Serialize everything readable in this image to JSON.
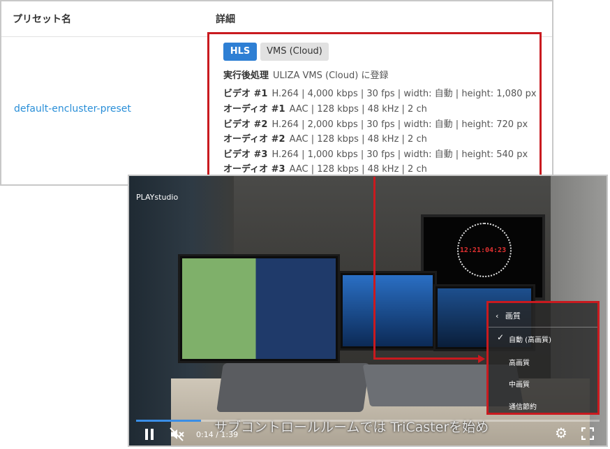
{
  "table": {
    "header_name": "プリセット名",
    "header_detail": "詳細",
    "preset_name": "default-encluster-preset"
  },
  "detail": {
    "tab_hls": "HLS",
    "tab_vms": "VMS (Cloud)",
    "post_label": "実行後処理",
    "post_value": "ULIZA VMS (Cloud) に登録",
    "lines": [
      {
        "label": "ビデオ #1",
        "value": "H.264 | 4,000 kbps | 30 fps | width: 自動 | height: 1,080 px"
      },
      {
        "label": "オーディオ #1",
        "value": "AAC | 128 kbps | 48 kHz | 2 ch"
      },
      {
        "label": "ビデオ #2",
        "value": "H.264 | 2,000 kbps | 30 fps | width: 自動 | height: 720 px"
      },
      {
        "label": "オーディオ #2",
        "value": "AAC | 128 kbps | 48 kHz | 2 ch"
      },
      {
        "label": "ビデオ #3",
        "value": "H.264 | 1,000 kbps | 30 fps | width: 自動 | height: 540 px"
      },
      {
        "label": "オーディオ #3",
        "value": "AAC | 128 kbps | 48 kHz | 2 ch"
      }
    ]
  },
  "player": {
    "brand": "PLAYstudio",
    "clock_time": "12:21:04:23",
    "subtitle": "サブコントロールルームでは TriCasterを始め",
    "time": "0:14 / 1:39",
    "progress": 0.14,
    "accent_color": "#3a8ee6",
    "icons": [
      "pause-icon",
      "mute-icon",
      "gear-icon",
      "fullscreen-icon"
    ]
  },
  "quality_menu": {
    "title": "画質",
    "items": [
      "自動 (高画質)",
      "高画質",
      "中画質",
      "通信節約"
    ],
    "selected": "自動 (高画質)"
  },
  "colors": {
    "highlight": "#c91a1f",
    "link": "#2a8fd8",
    "tab_active": "#2e7fd4"
  }
}
